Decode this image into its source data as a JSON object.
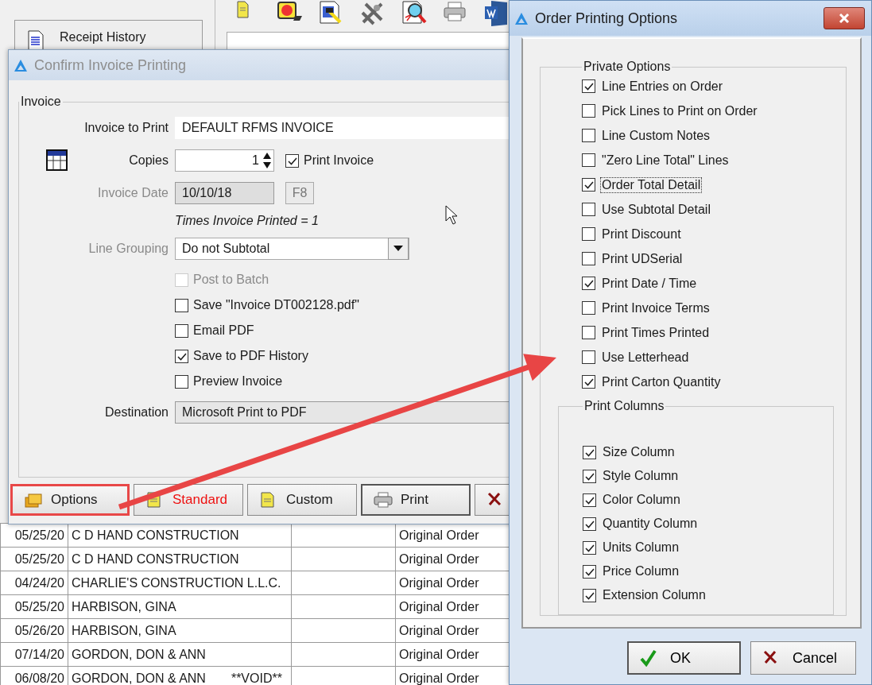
{
  "background": {
    "receipt_button": {
      "label": "Receipt History"
    }
  },
  "invoice_dialog": {
    "title": "Confirm Invoice Printing",
    "active": false,
    "group": "Invoice",
    "invoice_to_print": {
      "label": "Invoice to Print",
      "value": "DEFAULT RFMS INVOICE"
    },
    "copies": {
      "label": "Copies",
      "value": "1"
    },
    "print_invoice": {
      "label": "Print Invoice",
      "checked": true
    },
    "invoice_date": {
      "label": "Invoice Date",
      "value": "10/10/18",
      "disabled": true
    },
    "f8_button": {
      "label": "F8",
      "disabled": true
    },
    "times_printed": "Times Invoice Printed = 1",
    "line_grouping": {
      "label": "Line Grouping",
      "value": "Do not Subtotal",
      "disabled": true
    },
    "options": [
      {
        "label": "Post to Batch",
        "checked": false,
        "disabled": true
      },
      {
        "label": "Save \"Invoice DT002128.pdf\"",
        "checked": false,
        "disabled": false
      },
      {
        "label": "Email PDF",
        "checked": false,
        "disabled": false
      },
      {
        "label": "Save to PDF History",
        "checked": true,
        "disabled": false
      },
      {
        "label": "Preview Invoice",
        "checked": false,
        "disabled": false
      }
    ],
    "destination": {
      "label": "Destination",
      "value": "Microsoft Print to PDF"
    },
    "buttons": [
      {
        "kind": "options",
        "label": "Options",
        "annotated": true
      },
      {
        "kind": "standard",
        "label": "Standard",
        "annotated": false
      },
      {
        "kind": "custom",
        "label": "Custom",
        "annotated": false
      },
      {
        "kind": "print",
        "label": "Print",
        "annotated": false
      },
      {
        "kind": "cancel",
        "annotated": false
      }
    ]
  },
  "records": [
    {
      "date": "05/25/20",
      "name": "C D HAND CONSTRUCTION",
      "status": "Original Order"
    },
    {
      "date": "05/25/20",
      "name": "C D HAND CONSTRUCTION",
      "status": "Original Order"
    },
    {
      "date": "04/24/20",
      "name": "CHARLIE'S CONSTRUCTION L.L.C.",
      "status": "Original Order"
    },
    {
      "date": "05/25/20",
      "name": "HARBISON, GINA",
      "status": "Original Order"
    },
    {
      "date": "05/26/20",
      "name": "HARBISON, GINA",
      "status": "Original Order"
    },
    {
      "date": "07/14/20",
      "name": "GORDON, DON & ANN",
      "status": "Original Order"
    },
    {
      "date": "06/08/20",
      "name": "GORDON, DON & ANN",
      "flag": "**VOID**",
      "status": "Original Order"
    }
  ],
  "order_dialog": {
    "title": "Order Printing Options",
    "active": true,
    "private_group": "Private Options",
    "private_options": [
      {
        "label": "Line Entries on Order",
        "checked": true,
        "focused": false
      },
      {
        "label": "Pick Lines to Print on Order",
        "checked": false,
        "focused": false
      },
      {
        "label": "Line Custom Notes",
        "checked": false,
        "focused": false
      },
      {
        "label": "\"Zero Line Total\" Lines",
        "checked": false,
        "focused": false
      },
      {
        "label": "Order Total Detail",
        "checked": true,
        "focused": true
      },
      {
        "label": "Use Subtotal Detail",
        "checked": false,
        "focused": false
      },
      {
        "label": "Print Discount",
        "checked": false,
        "focused": false
      },
      {
        "label": "Print UDSerial",
        "checked": false,
        "focused": false
      },
      {
        "label": "Print Date / Time",
        "checked": true,
        "focused": false
      },
      {
        "label": "Print Invoice Terms",
        "checked": false,
        "focused": false
      },
      {
        "label": "Print Times Printed",
        "checked": false,
        "focused": false
      },
      {
        "label": "Use Letterhead",
        "checked": false,
        "focused": false
      },
      {
        "label": "Print Carton Quantity",
        "checked": true,
        "focused": false
      }
    ],
    "columns_group": "Print Columns",
    "column_options": [
      {
        "label": "Size Column",
        "checked": true
      },
      {
        "label": "Style Column",
        "checked": true
      },
      {
        "label": "Color Column",
        "checked": true
      },
      {
        "label": "Quantity Column",
        "checked": true
      },
      {
        "label": "Units Column",
        "checked": true
      },
      {
        "label": "Price Column",
        "checked": true
      },
      {
        "label": "Extension Column",
        "checked": true
      }
    ],
    "buttons": [
      {
        "kind": "ok",
        "label": "OK"
      },
      {
        "kind": "cancel",
        "label": "Cancel"
      }
    ]
  }
}
